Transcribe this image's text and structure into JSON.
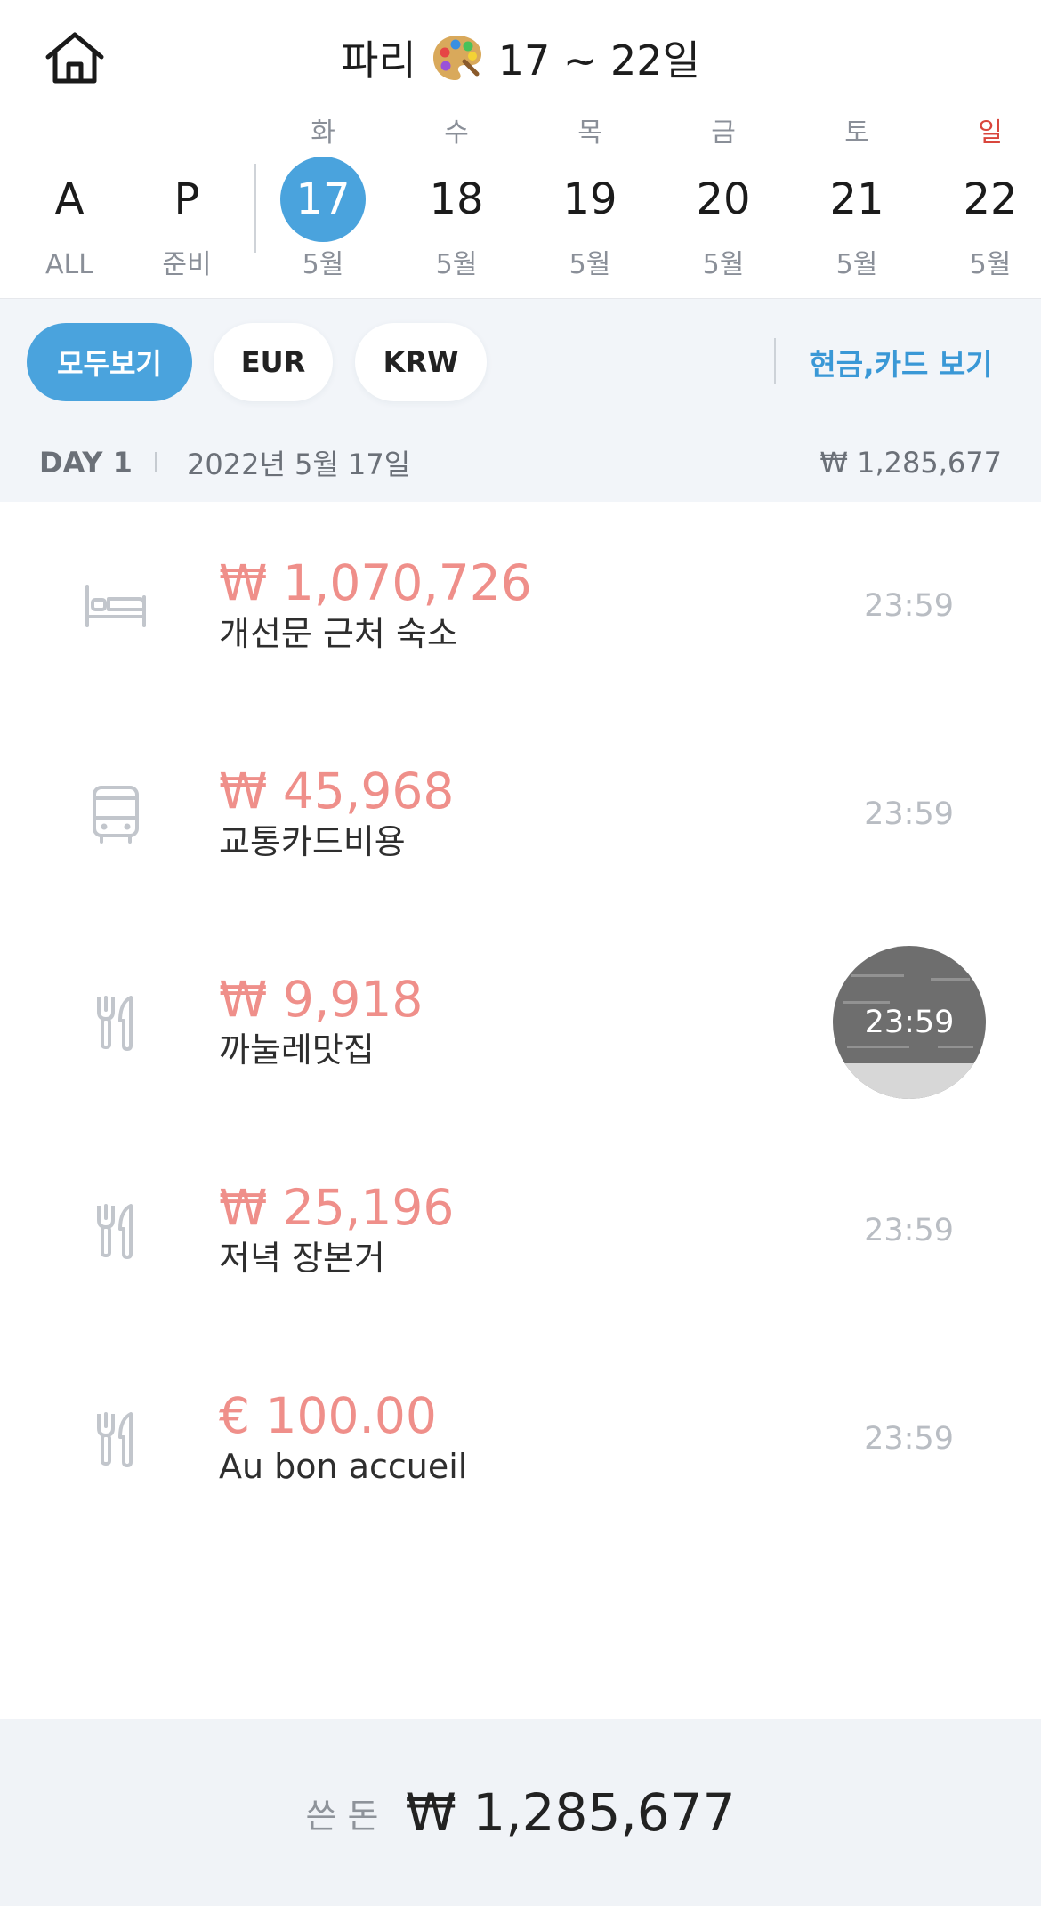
{
  "header": {
    "title_text": "파리",
    "title_emoji_icon": "palette-icon",
    "date_range": "17 ~ 22일",
    "home_icon": "home-icon"
  },
  "day_strip": {
    "special": [
      {
        "letter": "A",
        "sub": "ALL"
      },
      {
        "letter": "P",
        "sub": "준비"
      }
    ],
    "days": [
      {
        "weekday": "화",
        "num": "17",
        "month": "5월",
        "active": true
      },
      {
        "weekday": "수",
        "num": "18",
        "month": "5월"
      },
      {
        "weekday": "목",
        "num": "19",
        "month": "5월"
      },
      {
        "weekday": "금",
        "num": "20",
        "month": "5월"
      },
      {
        "weekday": "토",
        "num": "21",
        "month": "5월"
      },
      {
        "weekday": "일",
        "num": "22",
        "month": "5월",
        "sunday": true
      }
    ]
  },
  "filters": {
    "chips": [
      "모두보기",
      "EUR",
      "KRW"
    ],
    "active_chip": "모두보기",
    "cash_card_toggle": "현금,카드 보기"
  },
  "day_header": {
    "label": "DAY 1",
    "date": "2022년 5월 17일",
    "total": "₩ 1,285,677"
  },
  "expenses": [
    {
      "icon": "bed-icon",
      "amount": "₩ 1,070,726",
      "name": "개선문 근처 숙소",
      "time": "23:59"
    },
    {
      "icon": "bus-icon",
      "amount": "₩ 45,968",
      "name": "교통카드비용",
      "time": "23:59"
    },
    {
      "icon": "fork-knife-icon",
      "amount": "₩ 9,918",
      "name": "까눌레맛집",
      "time": "23:59",
      "has_receipt": true
    },
    {
      "icon": "fork-knife-icon",
      "amount": "₩ 25,196",
      "name": "저녁 장본거",
      "time": "23:59"
    },
    {
      "icon": "fork-knife-icon",
      "amount": "€ 100.00",
      "name": "Au bon accueil",
      "time": "23:59"
    }
  ],
  "footer": {
    "label": "쓴 돈",
    "total": "₩ 1,285,677"
  },
  "colors": {
    "accent": "#4aa3dd",
    "amount": "#ef8f8a",
    "sunday": "#d9463d",
    "toggle_text": "#3a98d6"
  }
}
